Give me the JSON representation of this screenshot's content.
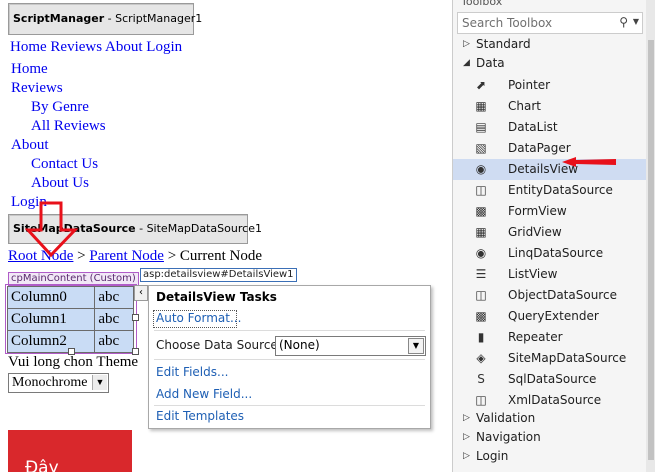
{
  "script_manager": {
    "type": "ScriptManager",
    "id": "ScriptManager1"
  },
  "menu_horizontal": [
    "Home",
    "Reviews",
    "About",
    "Login"
  ],
  "menu_vertical": [
    {
      "label": "Home",
      "indent": 0
    },
    {
      "label": "Reviews",
      "indent": 0
    },
    {
      "label": "By Genre",
      "indent": 1
    },
    {
      "label": "All Reviews",
      "indent": 1
    },
    {
      "label": "About",
      "indent": 0
    },
    {
      "label": "Contact Us",
      "indent": 1
    },
    {
      "label": "About Us",
      "indent": 1
    },
    {
      "label": "Login",
      "indent": 0
    }
  ],
  "sitemap_ds": {
    "type": "SiteMapDataSource",
    "id": "SiteMapDataSource1"
  },
  "breadcrumb": {
    "root": "Root Node",
    "sep1": " > ",
    "parent": "Parent Node",
    "sep2": " > ",
    "current": "Current Node"
  },
  "content_tag": "cpMainContent (Custom)",
  "control_tag": "asp:detailsview#DetailsView1",
  "details_rows": [
    {
      "field": "Column0",
      "value": "abc"
    },
    {
      "field": "Column1",
      "value": "abc"
    },
    {
      "field": "Column2",
      "value": "abc"
    }
  ],
  "theme_label": "Vui long chon Theme",
  "theme_select": "Monochrome",
  "red_block_text": "Đây",
  "tasks": {
    "title": "DetailsView Tasks",
    "auto_format": "Auto Format...",
    "choose_ds_label": "Choose Data Source:",
    "choose_ds_value": "(None)",
    "edit_fields": "Edit Fields...",
    "add_field": "Add New Field...",
    "edit_templates": "Edit Templates"
  },
  "toolbox": {
    "title": "Toolbox",
    "search_placeholder": "Search Toolbox",
    "categories_before": [
      "Standard"
    ],
    "open_category": "Data",
    "items": [
      "Pointer",
      "Chart",
      "DataList",
      "DataPager",
      "DetailsView",
      "EntityDataSource",
      "FormView",
      "GridView",
      "LinqDataSource",
      "ListView",
      "ObjectDataSource",
      "QueryExtender",
      "Repeater",
      "SiteMapDataSource",
      "SqlDataSource",
      "XmlDataSource"
    ],
    "selected_item": "DetailsView",
    "categories_after": [
      "Validation",
      "Navigation",
      "Login"
    ]
  },
  "colors": {
    "annotation_red": "#e8101a",
    "selection": "#cfdcf2",
    "table_fill": "#c9dcf5",
    "content_border": "#b05cc8",
    "link": "#1e5fb4",
    "red_block": "#d9282c"
  }
}
